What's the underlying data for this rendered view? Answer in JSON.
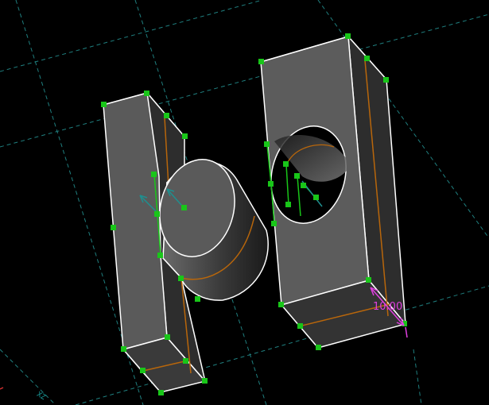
{
  "viewport": {
    "background": "#000000",
    "grid_color": "#1f7f7f",
    "edge_color": "#ffffff",
    "handle_color": "#19c619",
    "sketch_color": "#b8660b",
    "dimension_color": "#e040e0"
  },
  "dimension": {
    "value": "10.00"
  },
  "axis_label": {
    "text": "XZ"
  }
}
